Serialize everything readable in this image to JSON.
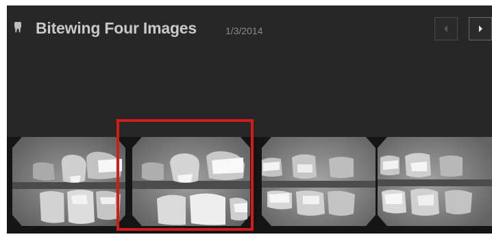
{
  "header": {
    "title": "Bitewing Four Images",
    "date": "1/3/2014",
    "icon": "tooth-icon",
    "prev_icon": "chevron-left-icon",
    "next_icon": "chevron-right-icon"
  },
  "thumbnails": [
    {
      "name": "bitewing-xray-1",
      "selected": false
    },
    {
      "name": "bitewing-xray-2",
      "selected": true
    },
    {
      "name": "bitewing-xray-3",
      "selected": false
    },
    {
      "name": "bitewing-xray-4",
      "selected": false
    }
  ],
  "colors": {
    "background": "#272727",
    "title": "#c9c9c9",
    "date": "#8a8a8a",
    "selection": "#d21c1c"
  }
}
